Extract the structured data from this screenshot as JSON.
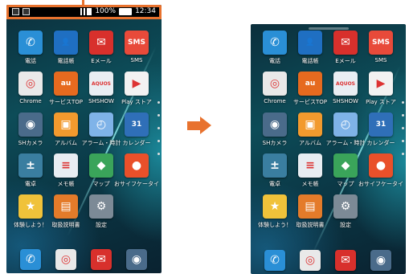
{
  "status_bar": {
    "battery": "100%",
    "time": "12:34"
  },
  "apps": [
    {
      "label": "電話",
      "icon": "phone-icon",
      "glyph": "✆",
      "color": "#2a8fd6"
    },
    {
      "label": "電話帳",
      "icon": "contacts-icon",
      "glyph": "👤",
      "color": "#1f6fc2"
    },
    {
      "label": "Eメール",
      "icon": "email-icon",
      "glyph": "✉",
      "color": "#d8302c"
    },
    {
      "label": "SMS",
      "icon": "sms-icon",
      "glyph": "SMS",
      "color": "#e84a3a"
    },
    {
      "label": "Chrome",
      "icon": "chrome-icon",
      "glyph": "◎",
      "color": "#e9e9e9"
    },
    {
      "label": "サービスTOP",
      "icon": "au-service-icon",
      "glyph": "au",
      "color": "#e66a1f"
    },
    {
      "label": "SHSHOW",
      "icon": "shshow-icon",
      "glyph": "AQUOS",
      "color": "#e9eef3"
    },
    {
      "label": "Play ストア",
      "icon": "play-store-icon",
      "glyph": "▶",
      "color": "#f2f2f2"
    },
    {
      "label": "SHカメラ",
      "icon": "camera-icon",
      "glyph": "◉",
      "color": "#4a6b8a"
    },
    {
      "label": "アルバム",
      "icon": "album-icon",
      "glyph": "▣",
      "color": "#f29a2e"
    },
    {
      "label": "アラーム・時計",
      "icon": "clock-icon",
      "glyph": "◴",
      "color": "#7fb3e8"
    },
    {
      "label": "カレンダー",
      "icon": "calendar-icon",
      "glyph": "31",
      "color": "#2f6fb8"
    },
    {
      "label": "電卓",
      "icon": "calculator-icon",
      "glyph": "±",
      "color": "#3a7ea0"
    },
    {
      "label": "メモ帳",
      "icon": "memo-icon",
      "glyph": "≡",
      "color": "#e8edf2"
    },
    {
      "label": "マップ",
      "icon": "maps-icon",
      "glyph": "◆",
      "color": "#3aa45a"
    },
    {
      "label": "おサイフケータイ",
      "icon": "osaifu-icon",
      "glyph": "●",
      "color": "#e9502a"
    },
    {
      "label": "体験しよう！",
      "icon": "trial-icon",
      "glyph": "★",
      "color": "#f0c23a"
    },
    {
      "label": "取扱説明書",
      "icon": "manual-icon",
      "glyph": "▤",
      "color": "#e47b2a"
    },
    {
      "label": "設定",
      "icon": "settings-icon",
      "glyph": "⚙",
      "color": "#7c8a96"
    }
  ],
  "dock": [
    {
      "icon": "dock-phone-icon",
      "glyph": "✆",
      "color": "#2a8fd6"
    },
    {
      "icon": "dock-chrome-icon",
      "glyph": "◎",
      "color": "#e9e9e9"
    },
    {
      "icon": "dock-email-icon",
      "glyph": "✉",
      "color": "#d8302c"
    },
    {
      "icon": "dock-camera-icon",
      "glyph": "◉",
      "color": "#4a6b8a"
    }
  ],
  "accent_color": "#e8722e"
}
